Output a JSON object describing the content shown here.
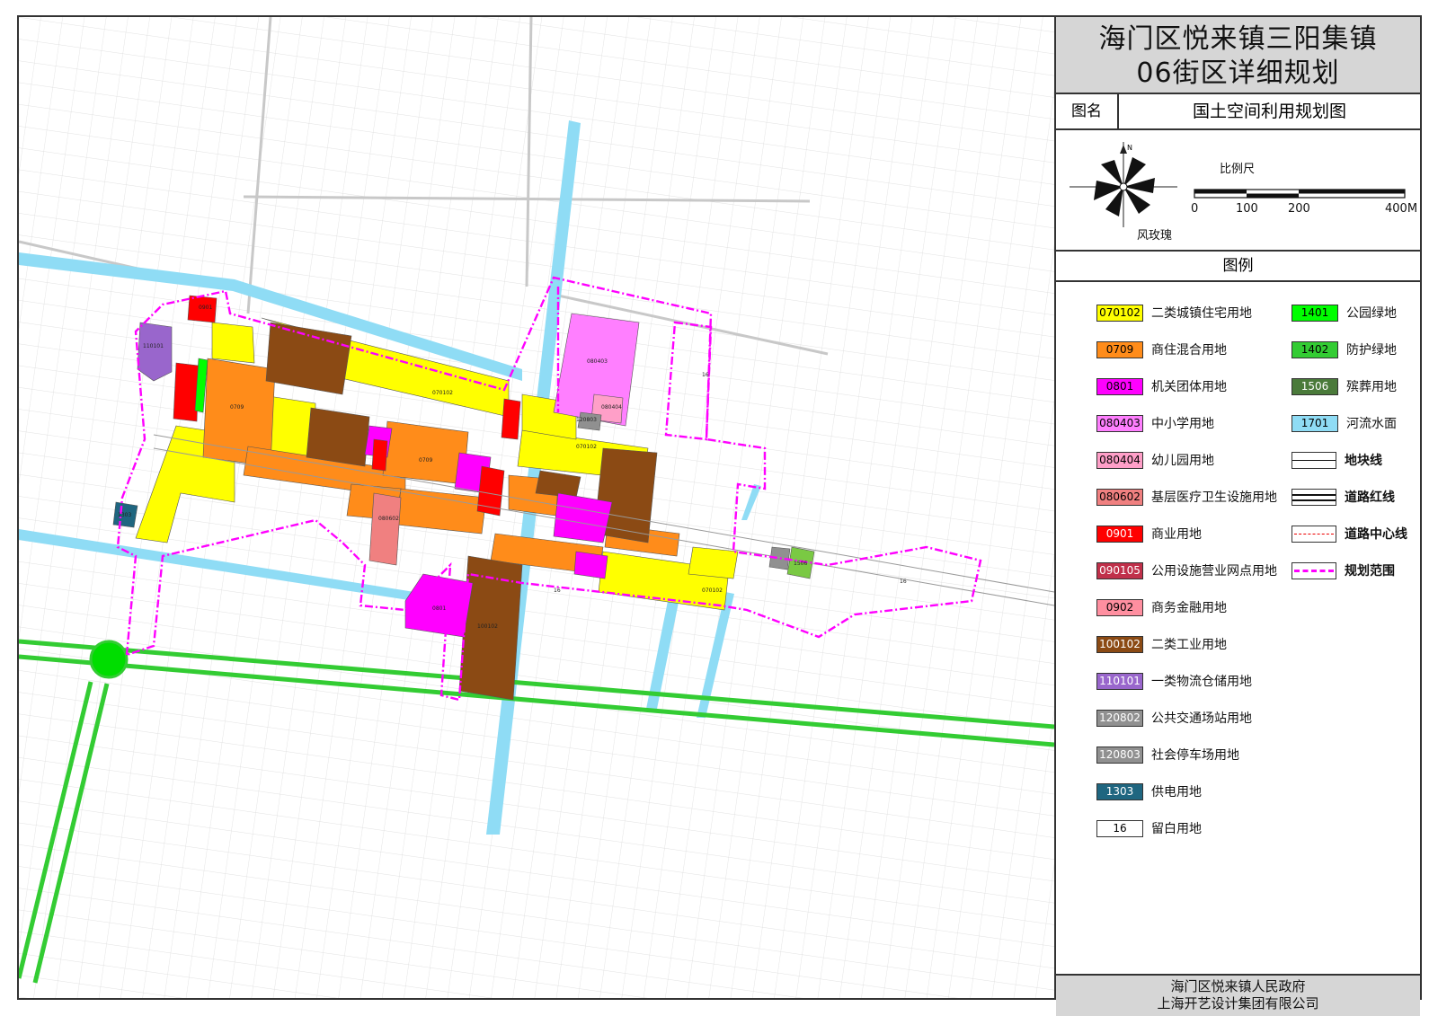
{
  "title": {
    "line1": "海门区悦来镇三阳集镇",
    "line2": "06街区详细规划"
  },
  "map_name": {
    "label": "图名",
    "value": "国土空间利用规划图"
  },
  "compass": {
    "north": "N",
    "label": "风玫瑰"
  },
  "scale_bar": {
    "title": "比例尺",
    "ticks": [
      "0",
      "100",
      "200",
      "400M"
    ]
  },
  "legend": {
    "heading": "图例",
    "land_use": [
      {
        "code": "070102",
        "label": "二类城镇住宅用地",
        "color": "#ffff00"
      },
      {
        "code": "0709",
        "label": "商住混合用地",
        "color": "#ff8c1a"
      },
      {
        "code": "0801",
        "label": "机关团体用地",
        "color": "#ff00ff"
      },
      {
        "code": "080403",
        "label": "中小学用地",
        "color": "#ff7fff"
      },
      {
        "code": "080404",
        "label": "幼儿园用地",
        "color": "#ff9fc8"
      },
      {
        "code": "080602",
        "label": "基层医疗卫生设施用地",
        "color": "#f08080"
      },
      {
        "code": "0901",
        "label": "商业用地",
        "color": "#ff0000"
      },
      {
        "code": "090105",
        "label": "公用设施营业网点用地",
        "color": "#c0304a"
      },
      {
        "code": "0902",
        "label": "商务金融用地",
        "color": "#ff8fa0"
      },
      {
        "code": "100102",
        "label": "二类工业用地",
        "color": "#8b4a14"
      },
      {
        "code": "110101",
        "label": "一类物流仓储用地",
        "color": "#9966cc"
      },
      {
        "code": "120802",
        "label": "公共交通场站用地",
        "color": "#909090"
      },
      {
        "code": "120803",
        "label": "社会停车场用地",
        "color": "#909090"
      },
      {
        "code": "1303",
        "label": "供电用地",
        "color": "#1f6680"
      },
      {
        "code": "16",
        "label": "留白用地",
        "color": "#ffffff"
      }
    ],
    "green_water": [
      {
        "code": "1401",
        "label": "公园绿地",
        "color": "#00ff00"
      },
      {
        "code": "1402",
        "label": "防护绿地",
        "color": "#33cc33"
      },
      {
        "code": "1506",
        "label": "殡葬用地",
        "color": "#4a7a3a"
      },
      {
        "code": "1701",
        "label": "河流水面",
        "color": "#8fdcf5"
      }
    ],
    "lines": [
      {
        "label": "地块线"
      },
      {
        "label": "道路红线"
      },
      {
        "label": "道路中心线"
      },
      {
        "label": "规划范围"
      }
    ]
  },
  "footer": {
    "line1": "海门区悦来镇人民政府",
    "line2": "上海开艺设计集团有限公司"
  },
  "map_parcel_labels": [
    "070102",
    "0709",
    "0801",
    "080403",
    "080404",
    "0901",
    "110101",
    "100102",
    "1303",
    "1506",
    "16",
    "080602",
    "120803",
    "1401",
    "1402"
  ],
  "colors": {
    "frame": "#333333",
    "title_bg": "#d6d6d6",
    "planning_boundary": "#ff00ff",
    "road_green": "#33cc33",
    "water": "#8fdcf5"
  }
}
